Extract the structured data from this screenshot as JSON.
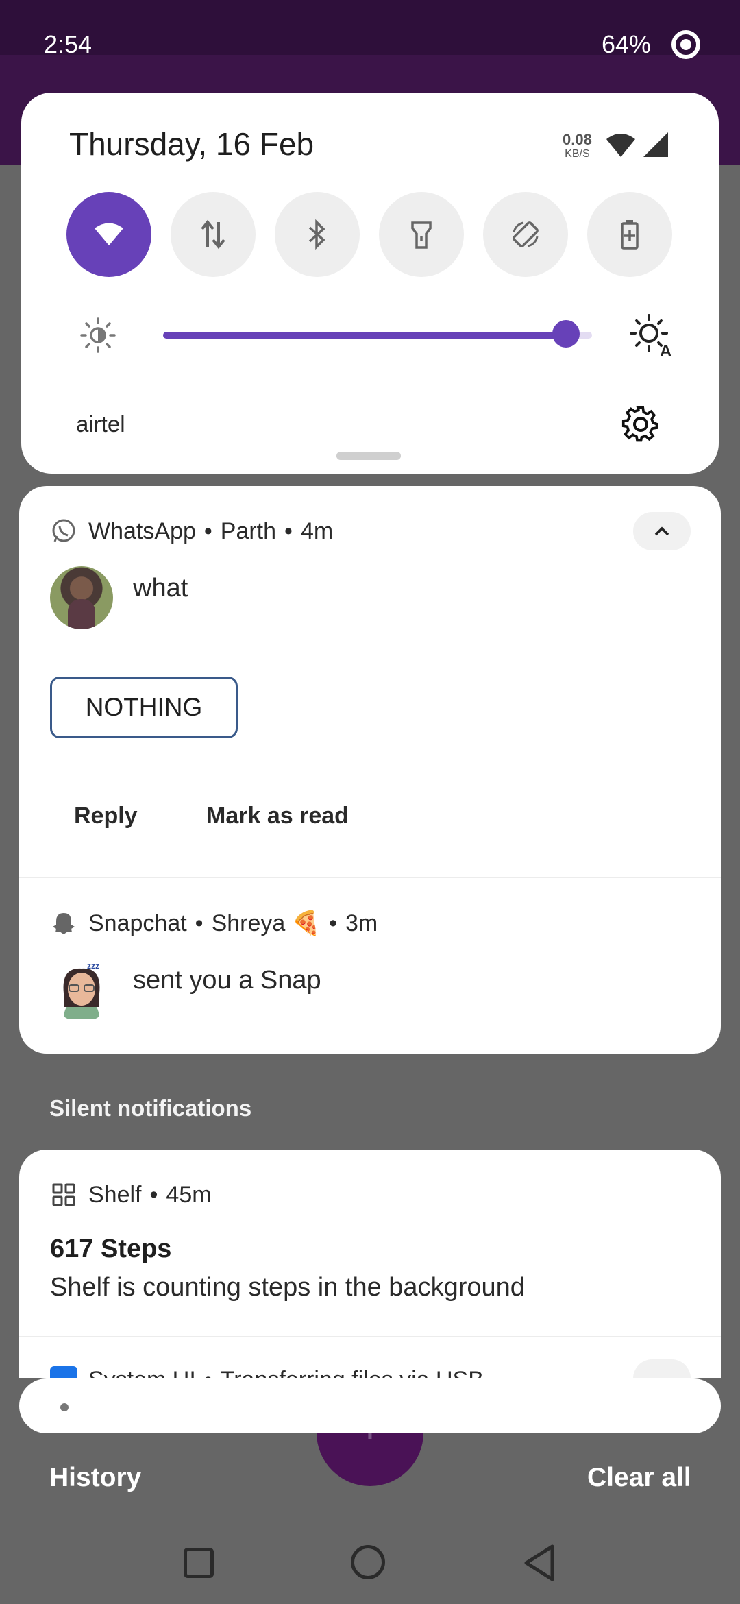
{
  "status_bar": {
    "time": "2:54",
    "battery": "64%"
  },
  "quick_settings": {
    "date": "Thursday, 16 Feb",
    "net_speed_value": "0.08",
    "net_speed_unit": "KB/S",
    "tiles": [
      {
        "name": "wifi",
        "active": true
      },
      {
        "name": "mobile-data",
        "active": false
      },
      {
        "name": "bluetooth",
        "active": false
      },
      {
        "name": "flashlight",
        "active": false
      },
      {
        "name": "auto-rotate",
        "active": false
      },
      {
        "name": "battery-saver",
        "active": false
      }
    ],
    "brightness_level": 0.94,
    "carrier": "airtel",
    "accent_color": "#6741b8"
  },
  "notifications": {
    "whatsapp": {
      "app": "WhatsApp",
      "sender": "Parth",
      "time": "4m",
      "message": "what",
      "smart_reply": "NOTHING",
      "actions": [
        "Reply",
        "Mark as read"
      ]
    },
    "snapchat": {
      "app": "Snapchat",
      "sender": "Shreya 🍕",
      "time": "3m",
      "message": "sent you a Snap"
    }
  },
  "silent": {
    "label": "Silent notifications",
    "shelf": {
      "app": "Shelf",
      "time": "45m",
      "title": "617 Steps",
      "text": "Shelf is counting steps in the background"
    },
    "system_ui": {
      "app": "System UI",
      "text": "Transferring files via USB"
    }
  },
  "footer": {
    "history": "History",
    "clear_all": "Clear all"
  }
}
